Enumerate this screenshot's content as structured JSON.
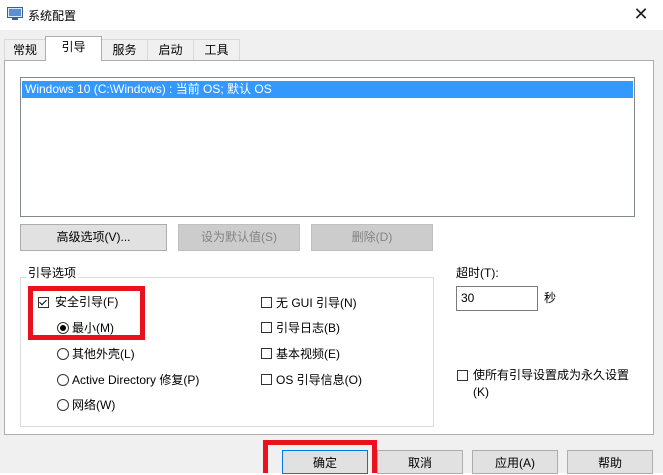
{
  "window": {
    "title": "系统配置"
  },
  "tabs": [
    {
      "label": "常规"
    },
    {
      "label": "引导"
    },
    {
      "label": "服务"
    },
    {
      "label": "启动"
    },
    {
      "label": "工具"
    }
  ],
  "boot_list": {
    "items": [
      "Windows 10 (C:\\Windows) : 当前 OS; 默认 OS"
    ]
  },
  "list_buttons": {
    "advanced": "高级选项(V)...",
    "set_default": "设为默认值(S)",
    "delete": "删除(D)"
  },
  "boot_options": {
    "group_label": "引导选项",
    "safe_boot": {
      "label": "安全引导(F)",
      "checked": true
    },
    "radios": [
      {
        "label": "最小(M)",
        "selected": true
      },
      {
        "label": "其他外壳(L)",
        "selected": false
      },
      {
        "label": "Active Directory 修复(P)",
        "selected": false
      },
      {
        "label": "网络(W)",
        "selected": false
      }
    ],
    "right_checks": [
      {
        "label": "无 GUI 引导(N)",
        "checked": false
      },
      {
        "label": "引导日志(B)",
        "checked": false
      },
      {
        "label": "基本视频(E)",
        "checked": false
      },
      {
        "label": "OS 引导信息(O)",
        "checked": false
      }
    ]
  },
  "timeout": {
    "label": "超时(T):",
    "value": "30",
    "unit": "秒"
  },
  "permanent": {
    "label_line1": "使所有引导设置成为永久设置",
    "label_line2": "(K)",
    "checked": false
  },
  "dialog_buttons": {
    "ok": "确定",
    "cancel": "取消",
    "apply": "应用(A)",
    "help": "帮助"
  },
  "colors": {
    "selection": "#3399ff",
    "highlight_box": "#e8111c"
  }
}
